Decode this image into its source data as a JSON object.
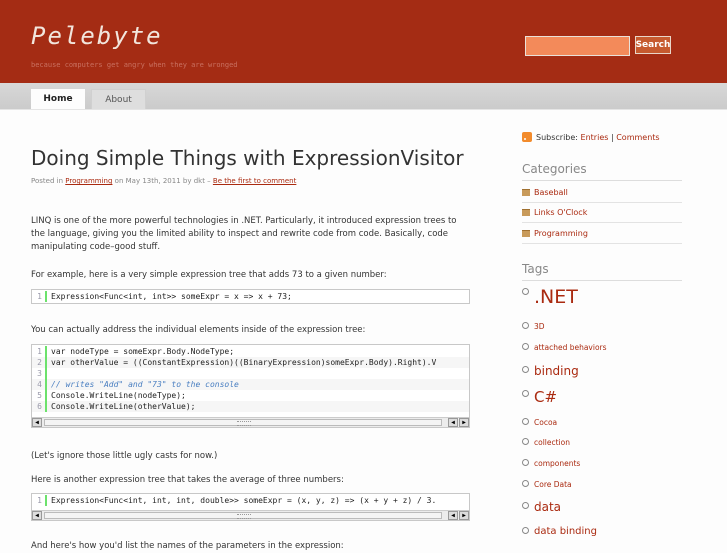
{
  "header": {
    "site_title": "Pelebyte",
    "tagline": "because computers get angry when they are wronged",
    "search_button": "Search",
    "search_value": ""
  },
  "nav": {
    "tabs": [
      {
        "label": "Home",
        "active": true
      },
      {
        "label": "About",
        "active": false
      }
    ]
  },
  "post": {
    "title": "Doing Simple Things with ExpressionVisitor",
    "meta": {
      "posted_in": "Posted in",
      "category": "Programming",
      "date_by": "on May 13th, 2011 by dkt –",
      "comment_link": "Be the first to comment"
    },
    "paragraphs": [
      "LINQ is one of the more powerful technologies in .NET. Particularly, it introduced expression trees to the language, giving you the limited ability to inspect and rewrite code from code. Basically, code manipulating code–good stuff.",
      "For example, here is a very simple expression tree that adds 73 to a given number:",
      "You can actually address the individual elements inside of the expression tree:",
      "(Let's ignore those little ugly casts for now.)",
      "Here is another expression tree that takes the average of three numbers:",
      "And here's how you'd list the names of the parameters in the expression:"
    ],
    "code_blocks": [
      {
        "lines": [
          {
            "n": "1",
            "text": "Expression<Func<int, int>> someExpr = x => x + 73;"
          }
        ]
      },
      {
        "lines": [
          {
            "n": "1",
            "text": "var nodeType = someExpr.Body.NodeType;"
          },
          {
            "n": "2",
            "text": "var otherValue = ((ConstantExpression)((BinaryExpression)someExpr.Body).Right).V"
          },
          {
            "n": "3",
            "text": ""
          },
          {
            "n": "4",
            "text": "// writes \"Add\" and \"73\" to the console"
          },
          {
            "n": "5",
            "text": "Console.WriteLine(nodeType);"
          },
          {
            "n": "6",
            "text": "Console.WriteLine(otherValue);"
          }
        ]
      },
      {
        "lines": [
          {
            "n": "1",
            "text": "Expression<Func<int, int, int, double>> someExpr = (x, y, z) => (x + y + z) / 3."
          }
        ]
      }
    ]
  },
  "sidebar": {
    "subscribe": {
      "label": "Subscribe:",
      "entries": "Entries",
      "sep": "|",
      "comments": "Comments"
    },
    "categories_heading": "Categories",
    "categories": [
      "Baseball",
      "Links O'Clock",
      "Programming"
    ],
    "tags_heading": "Tags",
    "tags": [
      {
        "label": ".NET",
        "size": "big"
      },
      {
        "label": "3D",
        "size": "small"
      },
      {
        "label": "attached behaviors",
        "size": "small"
      },
      {
        "label": "binding",
        "size": "mid"
      },
      {
        "label": "C#",
        "size": "large"
      },
      {
        "label": "Cocoa",
        "size": "small"
      },
      {
        "label": "collection",
        "size": "small"
      },
      {
        "label": "components",
        "size": "small"
      },
      {
        "label": "Core Data",
        "size": "small"
      },
      {
        "label": "data",
        "size": "mid"
      },
      {
        "label": "data binding",
        "size": "midsmall"
      }
    ]
  }
}
